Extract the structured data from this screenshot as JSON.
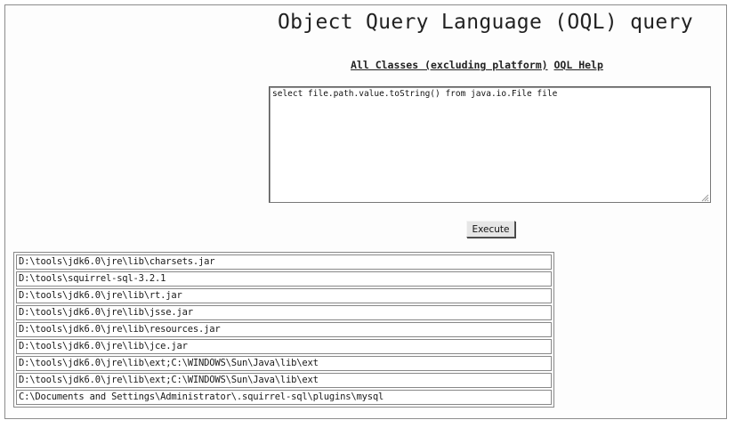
{
  "header": {
    "title": "Object Query Language (OQL) query"
  },
  "nav": {
    "all_classes_label": "All Classes (excluding platform)",
    "oql_help_label": "OQL Help"
  },
  "query": {
    "value": "select file.path.value.toString() from java.io.File file"
  },
  "execute_label": "Execute",
  "results": [
    "D:\\tools\\jdk6.0\\jre\\lib\\charsets.jar",
    "D:\\tools\\squirrel-sql-3.2.1",
    "D:\\tools\\jdk6.0\\jre\\lib\\rt.jar",
    "D:\\tools\\jdk6.0\\jre\\lib\\jsse.jar",
    "D:\\tools\\jdk6.0\\jre\\lib\\resources.jar",
    "D:\\tools\\jdk6.0\\jre\\lib\\jce.jar",
    "D:\\tools\\jdk6.0\\jre\\lib\\ext;C:\\WINDOWS\\Sun\\Java\\lib\\ext",
    "D:\\tools\\jdk6.0\\jre\\lib\\ext;C:\\WINDOWS\\Sun\\Java\\lib\\ext",
    "C:\\Documents and Settings\\Administrator\\.squirrel-sql\\plugins\\mysql"
  ],
  "icons": {
    "resize_grip": "resize-grip-icon"
  }
}
